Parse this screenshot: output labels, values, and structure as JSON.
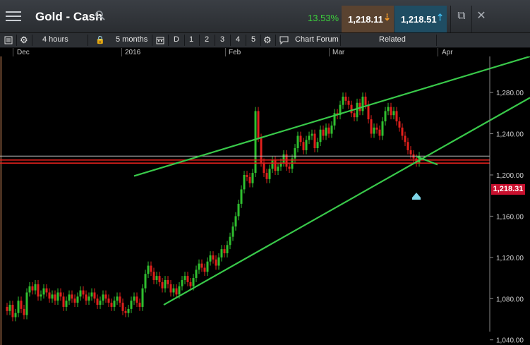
{
  "header": {
    "title": "Gold - Cash",
    "change_pct": "13.53%",
    "sell_price": "1,218.11",
    "buy_price": "1,218.51"
  },
  "toolbar": {
    "interval": "4 hours",
    "range": "5 months",
    "days": [
      "D",
      "1",
      "2",
      "3",
      "4",
      "5"
    ],
    "chart_forum": "Chart Forum",
    "related": "Related"
  },
  "chart_data": {
    "type": "line",
    "x_labels": [
      "Dec",
      "2016",
      "Feb",
      "Mar",
      "Apr"
    ],
    "y_ticks": [
      "1,280.00",
      "1,240.00",
      "1,200.00",
      "1,160.00",
      "1,120.00",
      "1,080.00",
      "1,040.00"
    ],
    "ylim": [
      1035,
      1315
    ],
    "series": [
      {
        "x": [
          0,
          4,
          8,
          12,
          16,
          20,
          24,
          28,
          32,
          36,
          40,
          44,
          48,
          52,
          56,
          60,
          64,
          68,
          72,
          76,
          80,
          84,
          88,
          92,
          96,
          100,
          104,
          108,
          112,
          116,
          120,
          124,
          128,
          132,
          136,
          140,
          144,
          148,
          152,
          156,
          160,
          164,
          168,
          172,
          176,
          180,
          184,
          188,
          192,
          196,
          200,
          204,
          208,
          212,
          216,
          220,
          224,
          228,
          232,
          236,
          240,
          244,
          248,
          252,
          256,
          260,
          264,
          268,
          272,
          276,
          280,
          284,
          288,
          292,
          296,
          300,
          304,
          308,
          312,
          316,
          320,
          324,
          328,
          332,
          336,
          340,
          344,
          348,
          352,
          356,
          360,
          364,
          368,
          372,
          376,
          380,
          384,
          388,
          392,
          396,
          400,
          404,
          408,
          412,
          416,
          420,
          424,
          428,
          432,
          436,
          440,
          444,
          448,
          452,
          456,
          460,
          464,
          468,
          472,
          476,
          480,
          484,
          488,
          492,
          496,
          500,
          504,
          508,
          512,
          516,
          520,
          524,
          528,
          532,
          536,
          540,
          544,
          548,
          552,
          556,
          560,
          564,
          568,
          572,
          576,
          580,
          584,
          588
        ],
        "values": [
          1072,
          1068,
          1074,
          1062,
          1066,
          1078,
          1070,
          1064,
          1086,
          1092,
          1088,
          1094,
          1082,
          1084,
          1090,
          1086,
          1080,
          1084,
          1078,
          1086,
          1082,
          1072,
          1078,
          1084,
          1080,
          1076,
          1082,
          1088,
          1084,
          1078,
          1082,
          1086,
          1080,
          1074,
          1078,
          1084,
          1080,
          1076,
          1072,
          1078,
          1082,
          1076,
          1068,
          1066,
          1070,
          1078,
          1082,
          1076,
          1072,
          1090,
          1104,
          1112,
          1106,
          1098,
          1102,
          1096,
          1090,
          1098,
          1094,
          1086,
          1090,
          1084,
          1092,
          1098,
          1102,
          1096,
          1092,
          1100,
          1108,
          1114,
          1110,
          1106,
          1116,
          1122,
          1118,
          1112,
          1120,
          1128,
          1124,
          1132,
          1140,
          1150,
          1160,
          1172,
          1186,
          1200,
          1198,
          1192,
          1202,
          1262,
          1236,
          1212,
          1202,
          1196,
          1206,
          1214,
          1204,
          1208,
          1212,
          1220,
          1208,
          1206,
          1216,
          1226,
          1238,
          1232,
          1224,
          1234,
          1238,
          1240,
          1226,
          1232,
          1244,
          1238,
          1246,
          1240,
          1248,
          1260,
          1258,
          1268,
          1276,
          1272,
          1268,
          1260,
          1256,
          1270,
          1262,
          1276,
          1268,
          1254,
          1240,
          1246,
          1244,
          1238,
          1252,
          1262,
          1266,
          1258,
          1262,
          1252,
          1246,
          1238,
          1232,
          1224,
          1220,
          1216,
          1212,
          1218.31
        ]
      }
    ],
    "channel_lines": [
      {
        "x": [
          190,
          751
        ],
        "values": [
          1199,
          1315
        ]
      },
      {
        "x": [
          232,
          751
        ],
        "values": [
          1074,
          1275
        ]
      },
      {
        "x": [
          590,
          620
        ],
        "values": [
          1218,
          1210
        ]
      }
    ],
    "horizontal_lines": [
      1218.31,
      1214.5,
      1211.5
    ],
    "last_price": "1,218.31"
  }
}
